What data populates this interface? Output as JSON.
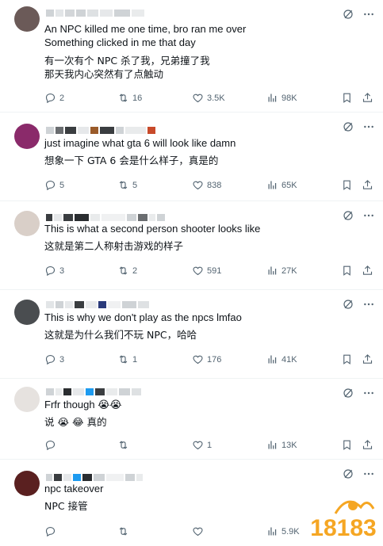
{
  "posts": [
    {
      "text_en": "An NPC killed me one time, bro ran me over\nSomething clicked in me that day",
      "text_zh": "有一次有个 NPC 杀了我，兄弟撞了我\n那天我内心突然有了点触动",
      "stats": {
        "replies": "2",
        "reposts": "16",
        "likes": "3.5K",
        "views": "98K"
      }
    },
    {
      "text_en": "just imagine what gta 6 will look like damn",
      "text_zh": "想象一下 GTA 6 会是什么样子，真是的",
      "stats": {
        "replies": "5",
        "reposts": "5",
        "likes": "838",
        "views": "65K"
      }
    },
    {
      "text_en": "This is what a second person shooter looks like",
      "text_zh": "这就是第二人称射击游戏的样子",
      "stats": {
        "replies": "3",
        "reposts": "2",
        "likes": "591",
        "views": "27K"
      }
    },
    {
      "text_en": "This is why we don't play as the npcs lmfao",
      "text_zh": "这就是为什么我们不玩 NPC，哈哈",
      "stats": {
        "replies": "3",
        "reposts": "1",
        "likes": "176",
        "views": "41K"
      }
    },
    {
      "text_en": "Frfr though 😭😭",
      "text_zh": "说 😭 😂 真的",
      "stats": {
        "replies": "",
        "reposts": "",
        "likes": "1",
        "views": "13K"
      }
    },
    {
      "text_en": "npc takeover",
      "text_zh": "NPC 接管",
      "stats": {
        "replies": "",
        "reposts": "",
        "likes": "",
        "views": "5.9K"
      }
    }
  ],
  "watermark": {
    "text": "18183"
  },
  "colors": {
    "icon": "#536471",
    "border": "#eff3f4",
    "watermark": "#f5a623"
  }
}
